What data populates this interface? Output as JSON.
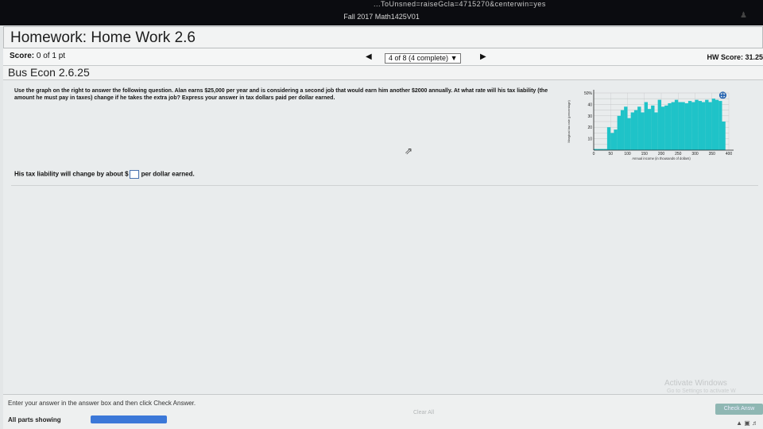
{
  "browser": {
    "url_fragment": "...ToUnsned=raiseGcla=4715270&centerwin=yes",
    "course_title": "Fall 2017 Math1425V01"
  },
  "header": {
    "title": "Homework: Home Work 2.6",
    "score_label": "Score:",
    "score_value": "0 of 1 pt",
    "progress": "4 of 8 (4 complete)",
    "hw_score": "HW Score: 31.25"
  },
  "question": {
    "id": "Bus Econ 2.6.25",
    "text": "Use the graph on the right to answer the following question. Alan earns $25,000 per year and is considering a second job that would earn him another $2000 annually. At what rate will his tax liability (the amount he must pay in taxes) change if he takes the extra job? Express your answer in tax dollars paid per dollar earned.",
    "answer_prefix": "His tax liability will change by about $",
    "answer_suffix": "per dollar earned.",
    "answer_value": ""
  },
  "footer": {
    "instructions": "Enter your answer in the answer box and then click Check Answer.",
    "clear_all": "Clear All",
    "check_answer": "Check Answ",
    "parts_showing": "All parts showing"
  },
  "watermark": {
    "title": "Activate Windows",
    "subtitle": "Go to Settings to activate W"
  },
  "colors": {
    "bar": "#1fc3c8",
    "accent": "#3b78d8"
  },
  "chart_data": {
    "type": "bar",
    "ylabel": "Marginal tax rate (percentage)",
    "xlabel": "Annual income (in thousands of dollars)",
    "xlim": [
      0,
      400
    ],
    "ylim": [
      0,
      50
    ],
    "y_ticks": [
      "10",
      "20",
      "30",
      "40",
      "50%"
    ],
    "y_tick_values": [
      10,
      20,
      30,
      40,
      50
    ],
    "x_ticks": [
      "0",
      "50",
      "100",
      "150",
      "200",
      "250",
      "300",
      "350",
      "400"
    ],
    "x_tick_values": [
      0,
      50,
      100,
      150,
      200,
      250,
      300,
      350,
      400
    ],
    "x": [
      10,
      20,
      30,
      40,
      50,
      60,
      70,
      80,
      90,
      100,
      110,
      120,
      130,
      140,
      150,
      160,
      170,
      180,
      190,
      200,
      210,
      220,
      230,
      240,
      250,
      260,
      270,
      280,
      290,
      300,
      310,
      320,
      330,
      340,
      350,
      360,
      370,
      380,
      390
    ],
    "values": [
      1,
      1,
      1,
      1,
      20,
      15,
      18,
      30,
      35,
      38,
      28,
      33,
      35,
      38,
      33,
      42,
      36,
      39,
      33,
      44,
      38,
      39,
      41,
      42,
      44,
      42,
      42,
      41,
      43,
      42,
      44,
      43,
      42,
      44,
      42,
      45,
      44,
      43,
      25
    ]
  }
}
